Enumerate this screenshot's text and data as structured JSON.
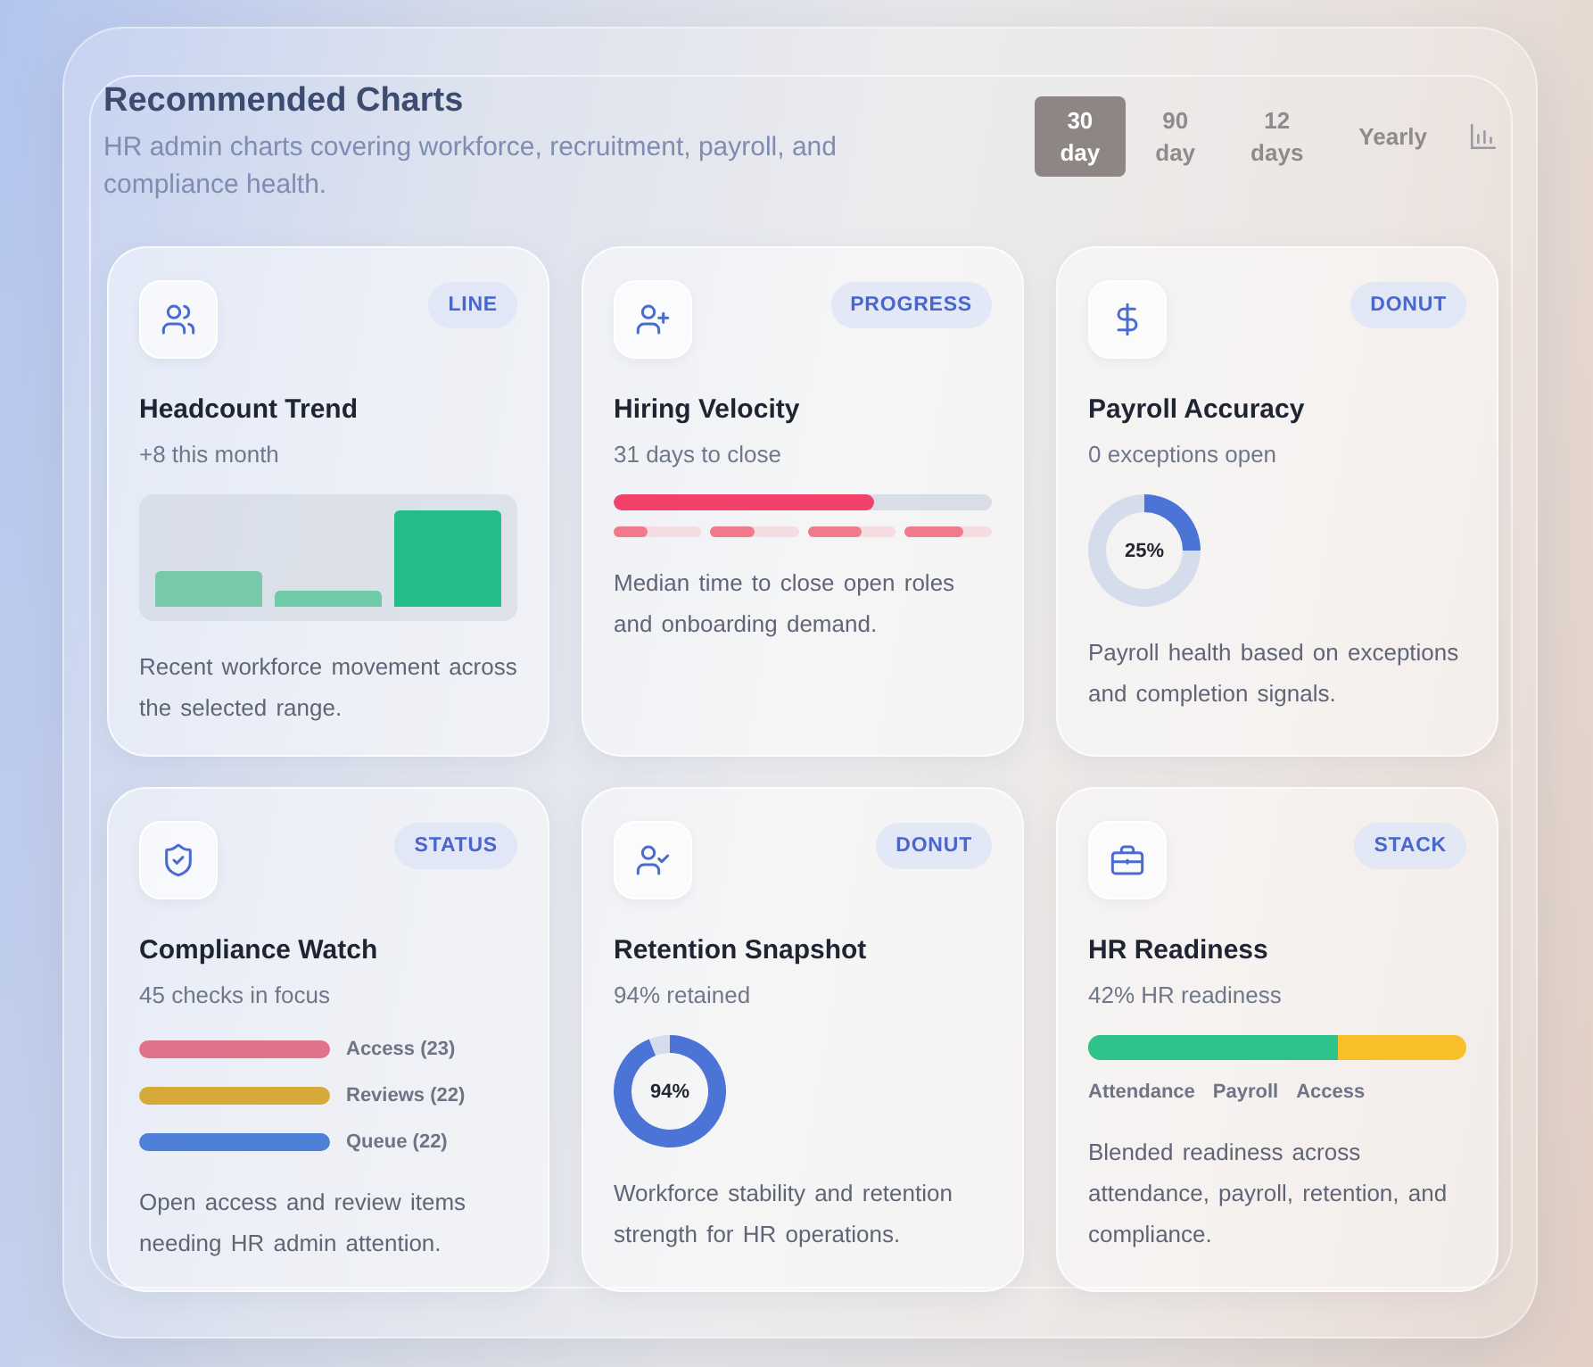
{
  "header": {
    "title": "Recommended Charts",
    "subtitle": "HR admin charts covering workforce, recruitment, payroll, and compliance health."
  },
  "ranges": [
    {
      "label": "30 day",
      "selected": true
    },
    {
      "label": "90 day",
      "selected": false
    },
    {
      "label": "12 days",
      "selected": false
    },
    {
      "label": "Yearly",
      "selected": false
    }
  ],
  "cards": [
    {
      "kind": "bars",
      "badge": "LINE",
      "title": "Headcount Trend",
      "subtitle": "+8 this month",
      "description": "Recent workforce movement across the selected range."
    },
    {
      "kind": "progress",
      "badge": "PROGRESS",
      "title": "Hiring Velocity",
      "subtitle": "31 days to close",
      "level": 0.69,
      "segments": [
        {
          "level": 0.38
        },
        {
          "level": 0.5
        },
        {
          "level": 0.62
        },
        {
          "level": 0.68
        }
      ],
      "description": "Median time to close open roles and onboarding demand."
    },
    {
      "kind": "donut",
      "badge": "DONUT",
      "title": "Payroll Accuracy",
      "subtitle": "0 exceptions open",
      "chart_data": {
        "type": "donut",
        "values": [
          25,
          75
        ]
      },
      "reading": "25%",
      "description": "Payroll health based on exceptions and completion signals."
    },
    {
      "kind": "status",
      "badge": "STATUS",
      "title": "Compliance Watch",
      "subtitle": "45 checks in focus",
      "items": [
        {
          "label": "Access (23)",
          "color": "#e0728a"
        },
        {
          "label": "Reviews (22)",
          "color": "#d6a93a"
        },
        {
          "label": "Queue (22)",
          "color": "#4f80d8"
        }
      ],
      "description": "Open access and review items needing HR admin attention."
    },
    {
      "kind": "donut",
      "badge": "DONUT",
      "title": "Retention Snapshot",
      "subtitle": "94% retained",
      "chart_data": {
        "type": "donut",
        "values": [
          94,
          6
        ]
      },
      "reading": "94%",
      "description": "Workforce stability and retention strength for HR operations."
    },
    {
      "kind": "stack",
      "badge": "STACK",
      "title": "HR Readiness",
      "subtitle": "42% HR readiness",
      "level": 0.66,
      "legend": [
        "Attendance",
        "Payroll",
        "Access"
      ],
      "description": "Blended readiness across attendance, payroll, retention, and compliance."
    }
  ]
}
